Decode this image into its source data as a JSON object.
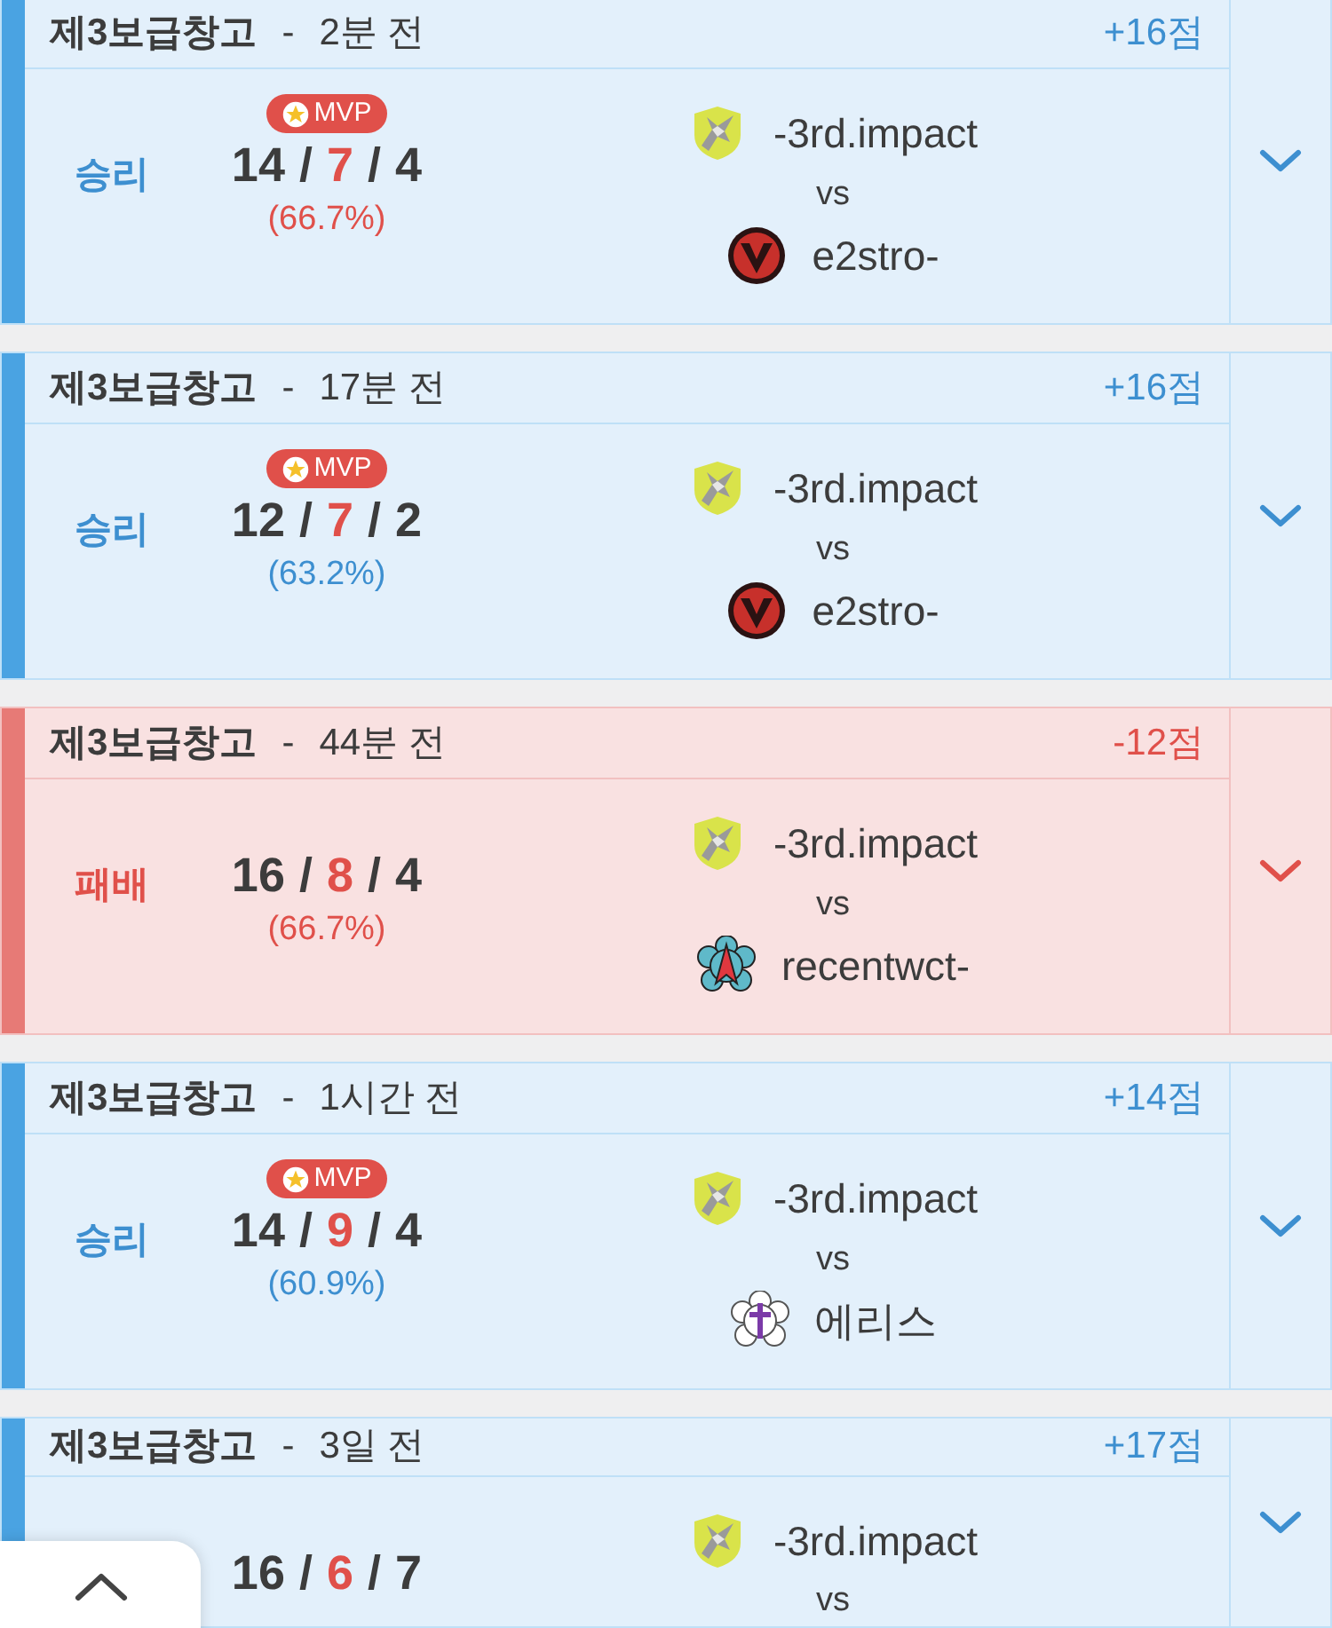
{
  "matches": [
    {
      "win": true,
      "map": "제3보급창고",
      "separator": "-",
      "time": "2분 전",
      "points": "+16점",
      "result": "승리",
      "mvp": "MVP",
      "kda": [
        {
          "text": "14",
          "highlight": false
        },
        {
          "text": "/",
          "highlight": false
        },
        {
          "text": "7",
          "highlight": true
        },
        {
          "text": "/",
          "highlight": false
        },
        {
          "text": "4",
          "highlight": false
        }
      ],
      "ratio": "(66.7%)",
      "ratio_highlight": true,
      "team": {
        "name": "-3rd.impact",
        "kind": "bird"
      },
      "vs": "vs",
      "opponent": {
        "name": "e2stro-",
        "kind": "v"
      }
    },
    {
      "win": true,
      "map": "제3보급창고",
      "separator": "-",
      "time": "17분 전",
      "points": "+16점",
      "result": "승리",
      "mvp": "MVP",
      "kda": [
        {
          "text": "12",
          "highlight": false
        },
        {
          "text": "/",
          "highlight": false
        },
        {
          "text": "7",
          "highlight": true
        },
        {
          "text": "/",
          "highlight": false
        },
        {
          "text": "2",
          "highlight": false
        }
      ],
      "ratio": "(63.2%)",
      "ratio_highlight": false,
      "team": {
        "name": "-3rd.impact",
        "kind": "bird"
      },
      "vs": "vs",
      "opponent": {
        "name": "e2stro-",
        "kind": "v"
      }
    },
    {
      "win": false,
      "map": "제3보급창고",
      "separator": "-",
      "time": "44분 전",
      "points": "-12점",
      "result": "패배",
      "kda": [
        {
          "text": "16",
          "highlight": false
        },
        {
          "text": "/",
          "highlight": false
        },
        {
          "text": "8",
          "highlight": true
        },
        {
          "text": "/",
          "highlight": false
        },
        {
          "text": "4",
          "highlight": false
        }
      ],
      "ratio": "(66.7%)",
      "ratio_highlight": true,
      "team": {
        "name": "-3rd.impact",
        "kind": "bird"
      },
      "vs": "vs",
      "opponent": {
        "name": "recentwct-",
        "kind": "star"
      }
    },
    {
      "win": true,
      "map": "제3보급창고",
      "separator": "-",
      "time": "1시간 전",
      "points": "+14점",
      "result": "승리",
      "mvp": "MVP",
      "kda": [
        {
          "text": "14",
          "highlight": false
        },
        {
          "text": "/",
          "highlight": false
        },
        {
          "text": "9",
          "highlight": true
        },
        {
          "text": "/",
          "highlight": false
        },
        {
          "text": "4",
          "highlight": false
        }
      ],
      "ratio": "(60.9%)",
      "ratio_highlight": false,
      "team": {
        "name": "-3rd.impact",
        "kind": "bird"
      },
      "vs": "vs",
      "opponent": {
        "name": "에리스",
        "kind": "cross"
      }
    },
    {
      "win": true,
      "map": "제3보급창고",
      "separator": "-",
      "time": "3일 전",
      "points": "+17점",
      "kda": [
        {
          "text": "16",
          "highlight": false
        },
        {
          "text": "/",
          "highlight": false
        },
        {
          "text": "6",
          "highlight": true
        },
        {
          "text": "/",
          "highlight": false
        },
        {
          "text": "7",
          "highlight": false
        }
      ],
      "team": {
        "name": "-3rd.impact",
        "kind": "bird"
      },
      "vs": "vs"
    }
  ],
  "scroll_top_button": {
    "kind": "caret-up"
  }
}
